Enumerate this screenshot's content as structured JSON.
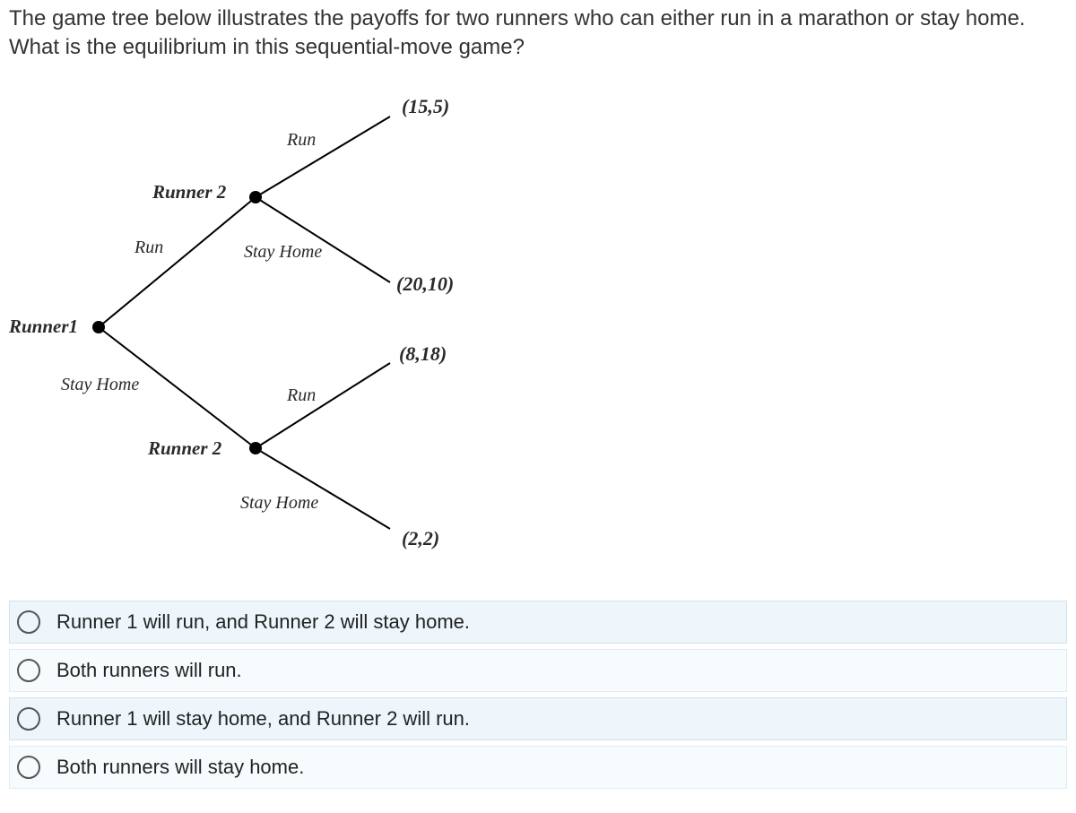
{
  "question": "The game tree below illustrates the payoffs for two runners who can either run in a marathon or stay home. What is the equilibrium in this sequential-move game?",
  "tree": {
    "root_label": "Runner1",
    "p1_actions": {
      "up": "Run",
      "down": "Stay Home"
    },
    "p2_label": "Runner 2",
    "p2_actions": {
      "up": "Run",
      "down": "Stay Home"
    },
    "payoffs": {
      "run_run": "(15,5)",
      "run_stay": "(20,10)",
      "stay_run": "(8,18)",
      "stay_stay": "(2,2)"
    }
  },
  "options": [
    "Runner 1 will run, and Runner 2 will stay home.",
    "Both runners will run.",
    "Runner 1 will stay home, and Runner 2 will run.",
    "Both runners will stay home."
  ]
}
